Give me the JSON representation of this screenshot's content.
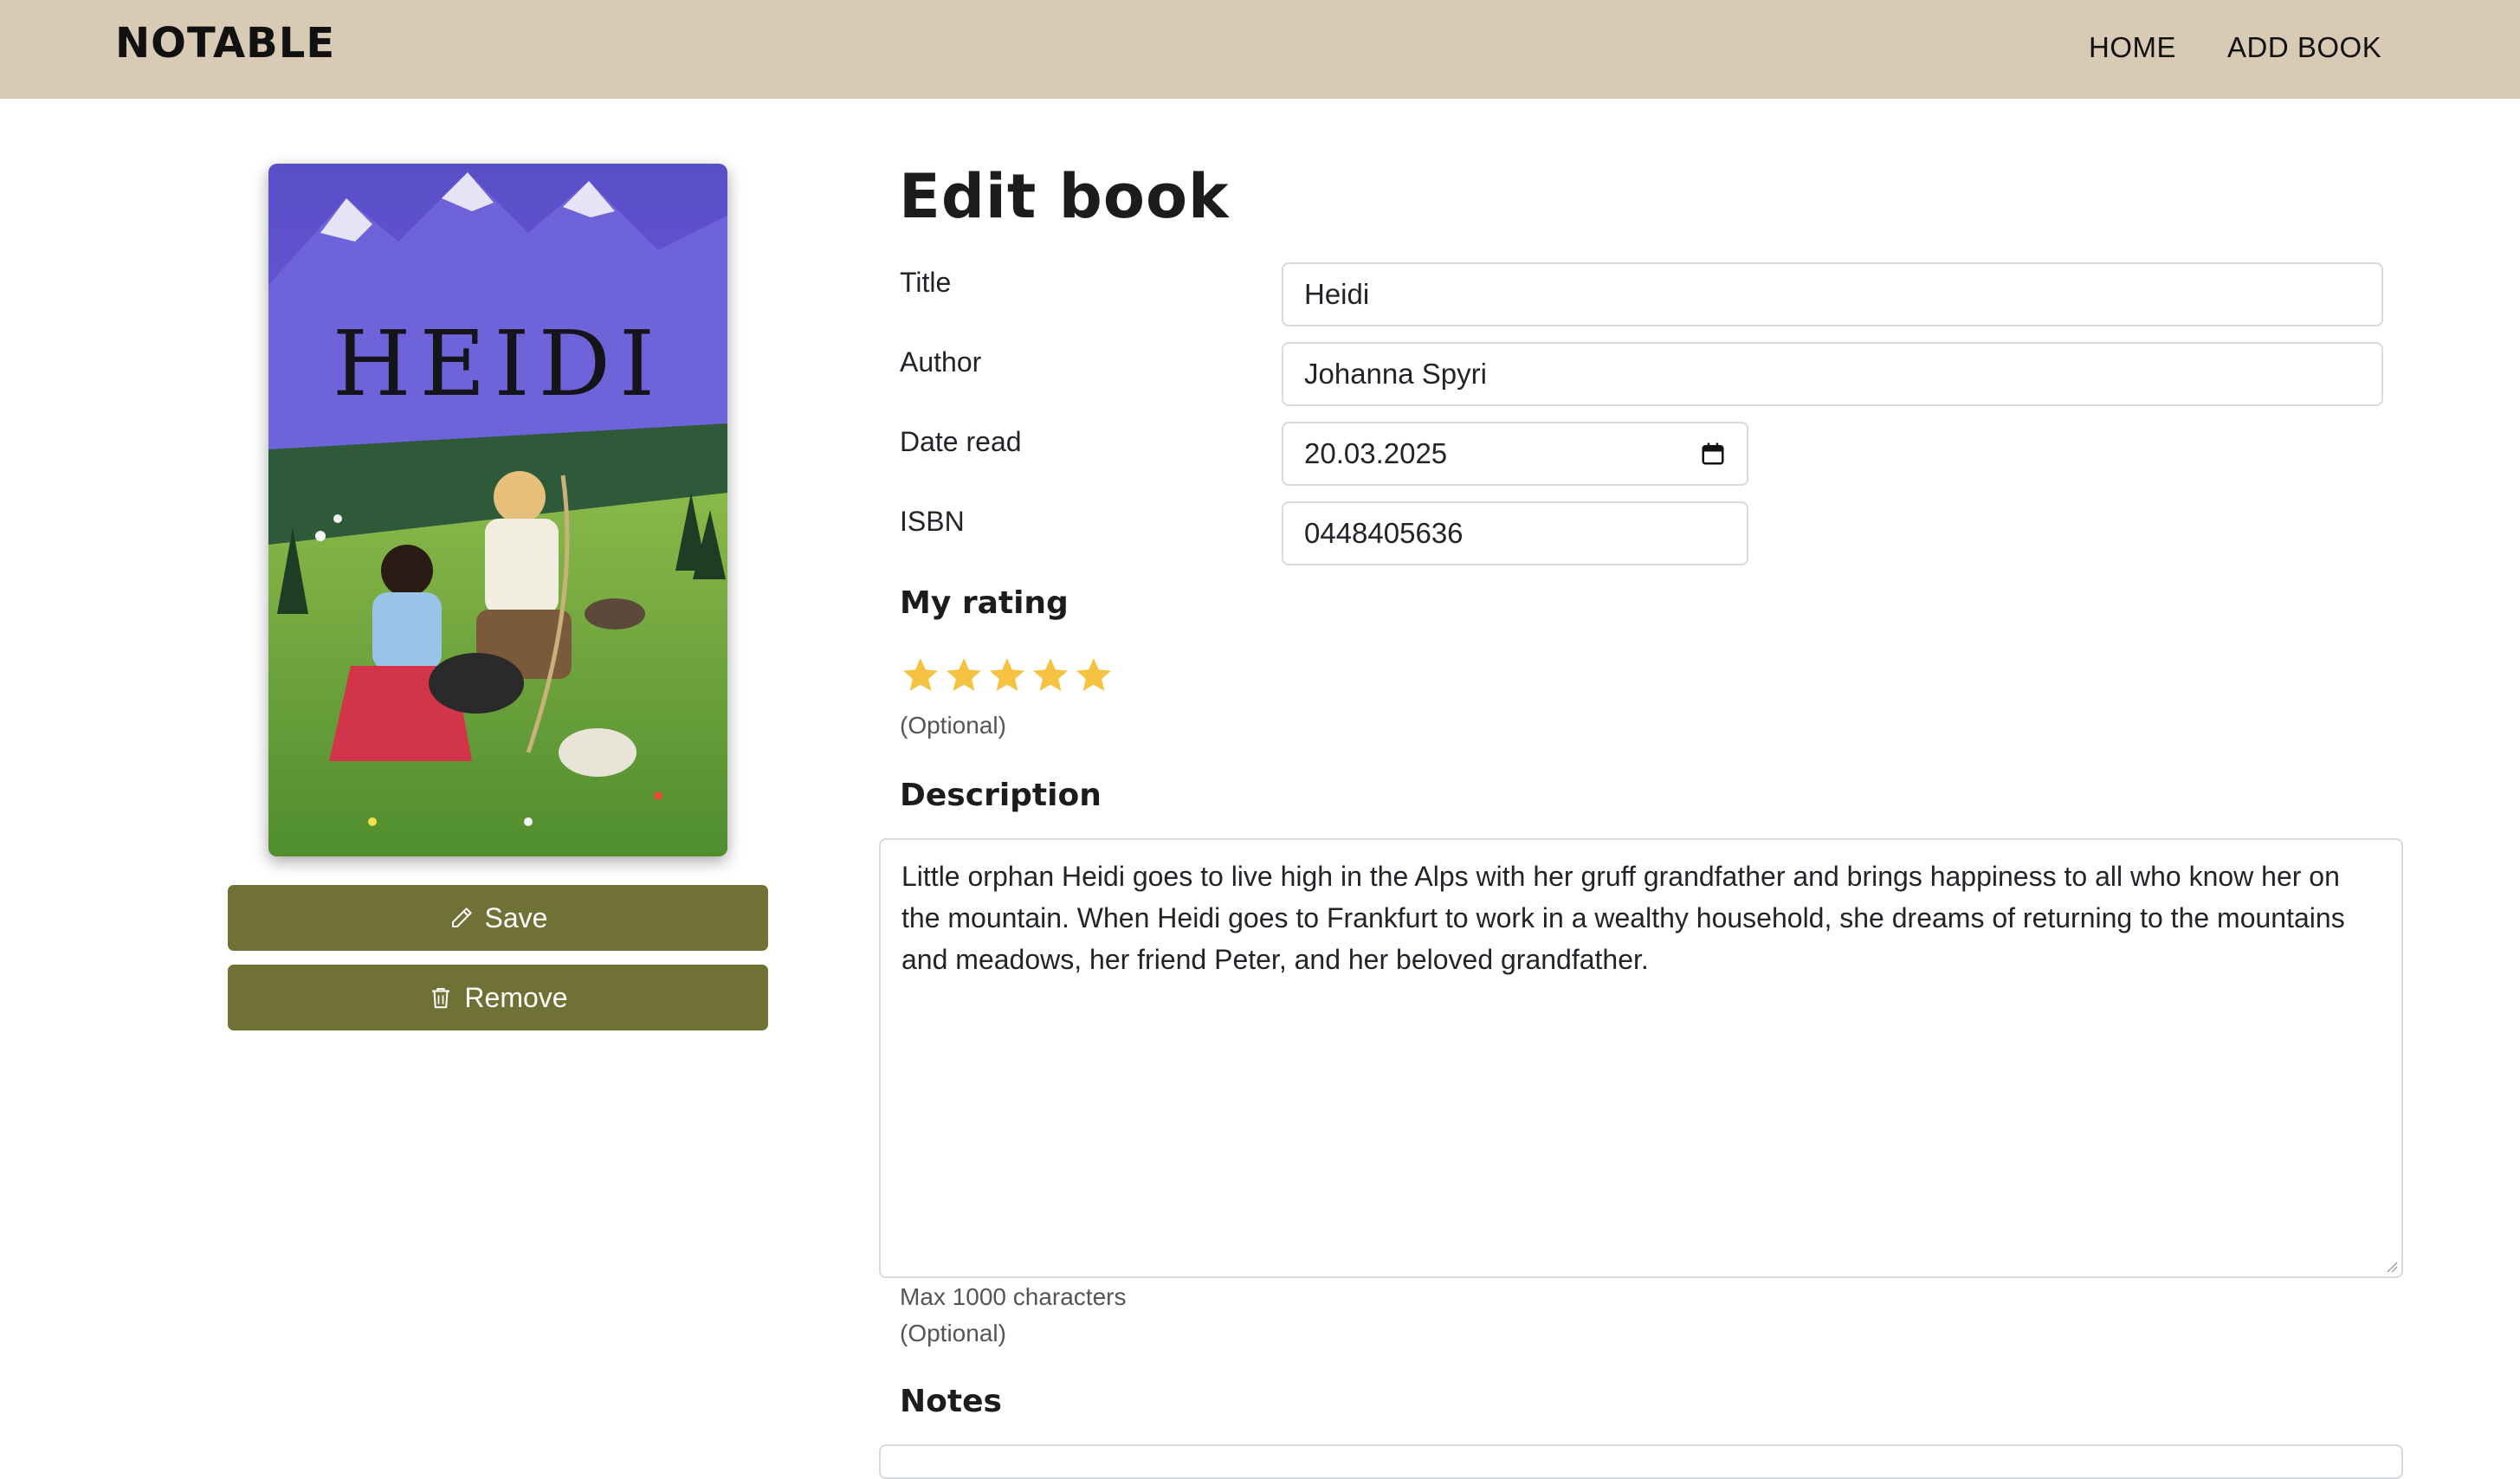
{
  "nav": {
    "brand": "NOTABLE",
    "links": [
      {
        "label": "HOME"
      },
      {
        "label": "ADD BOOK"
      }
    ]
  },
  "cover": {
    "title_text": "HEIDI"
  },
  "actions": {
    "save_label": "Save",
    "remove_label": "Remove",
    "save_icon": "pencil-icon",
    "remove_icon": "trash-icon"
  },
  "form": {
    "heading": "Edit book",
    "fields": {
      "title": {
        "label": "Title",
        "value": "Heidi"
      },
      "author": {
        "label": "Author",
        "value": "Johanna Spyri"
      },
      "date_read": {
        "label": "Date read",
        "value": "20.03.2025"
      },
      "isbn": {
        "label": "ISBN",
        "value": "0448405636"
      }
    },
    "rating": {
      "heading": "My rating",
      "value": 5,
      "max": 5,
      "hint": "(Optional)"
    },
    "description": {
      "heading": "Description",
      "value": "Little orphan Heidi goes to live high in the Alps with her gruff grandfather and brings happiness to all who know her on the mountain. When Heidi goes to Frankfurt to work in a wealthy household, she dreams of returning to the mountains and meadows, her friend Peter, and her beloved grandfather.",
      "hint_max": "Max 1000 characters",
      "hint_optional": "(Optional)"
    },
    "notes": {
      "heading": "Notes"
    }
  },
  "colors": {
    "navbar": "#d8cab5",
    "button": "#6f7135",
    "star": "#f5c242"
  }
}
